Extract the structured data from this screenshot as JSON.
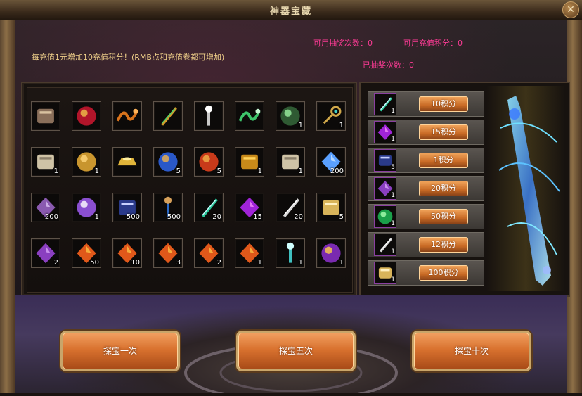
{
  "window": {
    "title": "神器宝藏",
    "close_label": "✕"
  },
  "info": {
    "recharge_text": "每充值1元增加10充值积分！(RMB点和充值卷都可增加)",
    "draws_available": "可用抽奖次数：0",
    "recharge_points": "可用充值积分：0",
    "draws_used": "已抽奖次数：0"
  },
  "grid": [
    [
      {
        "icon": "armor-gauntlet-icon",
        "count": ""
      },
      {
        "icon": "red-orb-icon",
        "count": ""
      },
      {
        "icon": "dragon-charm-icon",
        "count": ""
      },
      {
        "icon": "golden-sword-icon",
        "count": ""
      },
      {
        "icon": "silver-staff-icon",
        "count": ""
      },
      {
        "icon": "jade-whip-icon",
        "count": ""
      },
      {
        "icon": "green-emblem-icon",
        "count": "1"
      },
      {
        "icon": "ornate-key-icon",
        "count": "1"
      }
    ],
    [
      {
        "icon": "scroll-icon",
        "count": "1"
      },
      {
        "icon": "coins-icon",
        "count": "1"
      },
      {
        "icon": "gold-ingot-icon",
        "count": ""
      },
      {
        "icon": "blue-chest-orb-icon",
        "count": "5"
      },
      {
        "icon": "red-chest-orb-icon",
        "count": "5"
      },
      {
        "icon": "treasure-chest-icon",
        "count": "1"
      },
      {
        "icon": "scroll-icon",
        "count": "1"
      },
      {
        "icon": "blue-crystal-icon",
        "count": "200"
      }
    ],
    [
      {
        "icon": "purple-stone-icon",
        "count": "200"
      },
      {
        "icon": "purple-pearl-icon",
        "count": "1"
      },
      {
        "icon": "blue-book-icon",
        "count": "500"
      },
      {
        "icon": "blue-scrolls-icon",
        "count": "500"
      },
      {
        "icon": "feather-icon",
        "count": "20"
      },
      {
        "icon": "purple-gem-icon",
        "count": "15"
      },
      {
        "icon": "silver-boot-icon",
        "count": "20"
      },
      {
        "icon": "gold-scroll-icon",
        "count": "5"
      }
    ],
    [
      {
        "icon": "purple-egg-icon",
        "count": "2"
      },
      {
        "icon": "fire-crystal-icon",
        "count": "50"
      },
      {
        "icon": "fire-crystal-icon",
        "count": "10"
      },
      {
        "icon": "fire-crystal-icon",
        "count": "3"
      },
      {
        "icon": "fire-crystal-icon",
        "count": "2"
      },
      {
        "icon": "fire-crystal-icon",
        "count": "1"
      },
      {
        "icon": "potion-icon",
        "count": "1"
      },
      {
        "icon": "purple-amulet-icon",
        "count": "1"
      }
    ]
  ],
  "rewards": [
    {
      "icon": "feather-icon",
      "count": "1",
      "points": "10积分"
    },
    {
      "icon": "purple-gem-icon",
      "count": "1",
      "points": "15积分"
    },
    {
      "icon": "blue-book-icon",
      "count": "5",
      "points": "1积分"
    },
    {
      "icon": "purple-egg-icon",
      "count": "1",
      "points": "20积分"
    },
    {
      "icon": "green-orb-icon",
      "count": "1",
      "points": "50积分"
    },
    {
      "icon": "silver-boot-icon",
      "count": "1",
      "points": "12积分"
    },
    {
      "icon": "gold-scroll-icon",
      "count": "1",
      "points": "100积分"
    }
  ],
  "buttons": {
    "draw_once": "探宝一次",
    "draw_five": "探宝五次",
    "draw_ten": "探宝十次"
  }
}
